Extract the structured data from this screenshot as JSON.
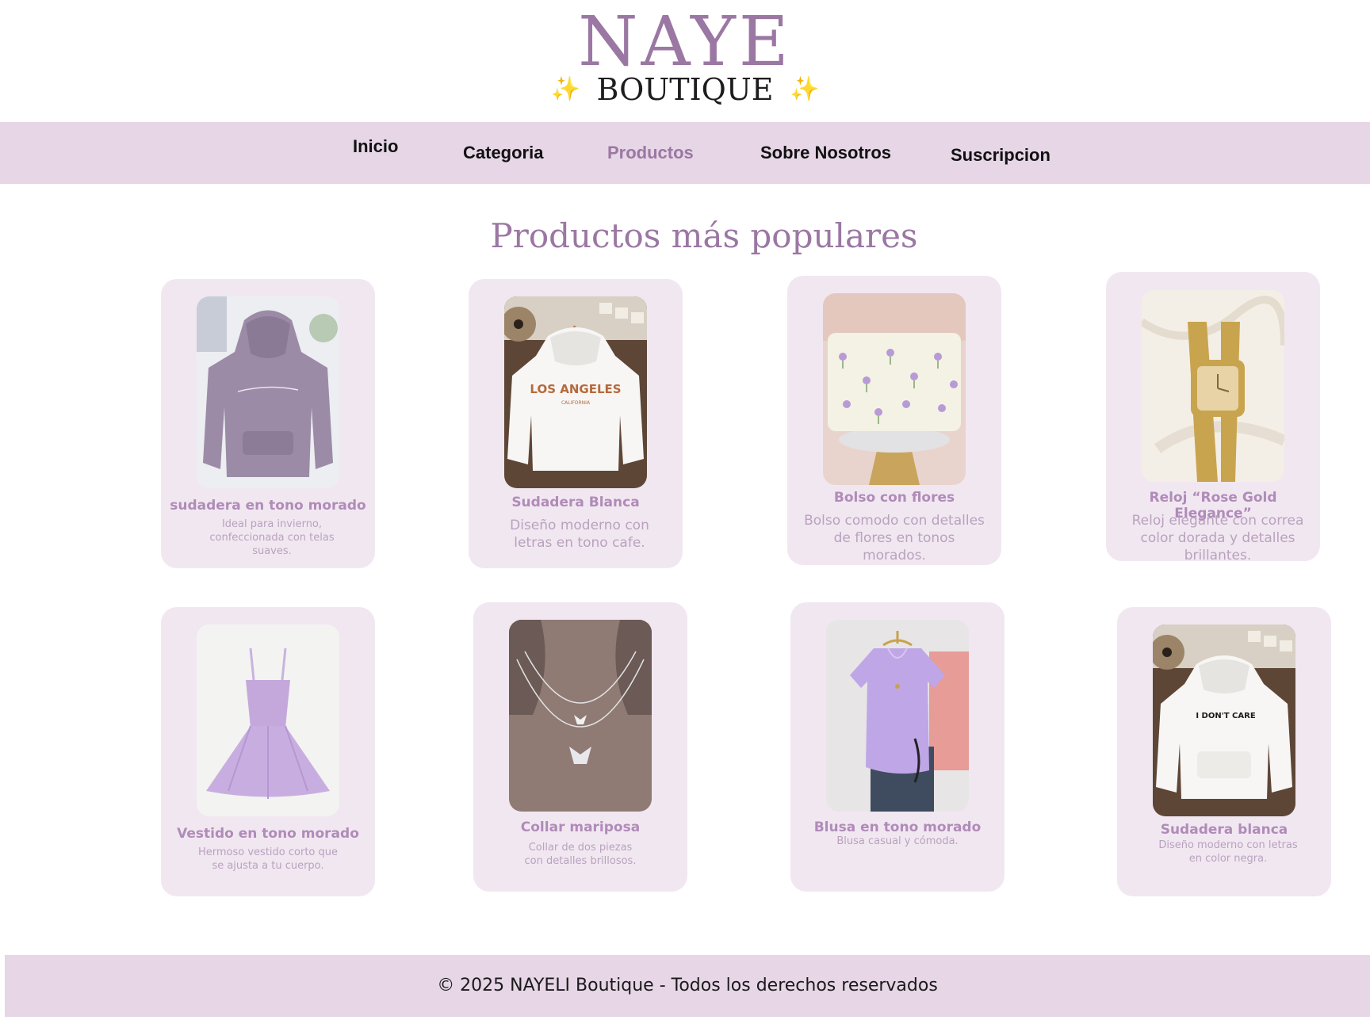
{
  "logo": {
    "name": "NAYE",
    "sub": "BOUTIQUE",
    "sparkle": "✨"
  },
  "nav": {
    "items": [
      {
        "label": "Inicio"
      },
      {
        "label": "Categoria"
      },
      {
        "label": "Productos"
      },
      {
        "label": "Sobre Nosotros"
      },
      {
        "label": "Suscripcion"
      }
    ],
    "active": "Productos"
  },
  "section_title": "Productos más populares",
  "products": [
    {
      "title": "sudadera en tono morado",
      "desc": "Ideal para invierno, confeccionada con telas suaves."
    },
    {
      "title": "Sudadera Blanca",
      "desc": "Diseño moderno con letras en tono cafe."
    },
    {
      "title": "Bolso con flores",
      "desc": "Bolso comodo con detalles de flores en tonos morados."
    },
    {
      "title": "Reloj “Rose Gold Elegance”",
      "desc": "Reloj elegante con correa color dorada y detalles brillantes."
    },
    {
      "title": "Vestido en tono morado",
      "desc": "Hermoso vestido corto que se ajusta a tu cuerpo."
    },
    {
      "title": "Collar mariposa",
      "desc": "Collar de dos piezas con detalles brillosos."
    },
    {
      "title": "Blusa en tono morado",
      "desc": "Blusa casual y cómoda."
    },
    {
      "title": "Sudadera blanca",
      "desc": "Diseño moderno con letras en color negra."
    }
  ],
  "image_text": {
    "la": "LOS ANGELES",
    "california": "CALIFORNIA",
    "idc": "I DON'T CARE"
  },
  "colors": {
    "accent": "#9b77a3",
    "nav_bg": "#e6d6e6",
    "card_bg": "#f1e7f1",
    "card_title": "#b08bb8",
    "card_desc": "#b9a2bd"
  },
  "footer": {
    "text": "© 2025 NAYELI Boutique - Todos los derechos reservados"
  }
}
